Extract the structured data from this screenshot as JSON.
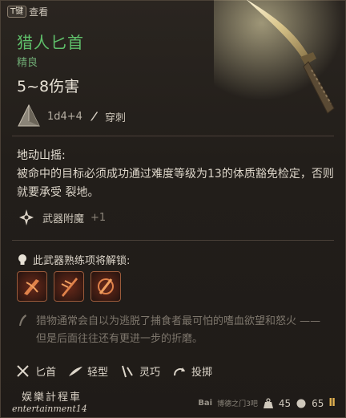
{
  "header": {
    "key_hint": "T键",
    "key_hint_label": "查看"
  },
  "item": {
    "name": "猎人匕首",
    "rarity": "精良",
    "damage": "5~8伤害",
    "damage_dice": "1d4+4",
    "damage_type": "穿刺"
  },
  "ability": {
    "title": "地动山摇:",
    "description": "被命中的目标必须成功通过难度等级为13的体质豁免检定，否则就要承受 裂地。"
  },
  "enchantment": {
    "label": "武器附魔",
    "bonus": "+1"
  },
  "proficiency": {
    "title": "此武器熟练项将解锁:",
    "skills": [
      "skill-1",
      "skill-2",
      "skill-3"
    ]
  },
  "lore": "猎物通常会自以为逃脱了捕食者最可怕的嗜血欲望和怒火 —— 但是后面往往还有更进一步的折磨。",
  "properties": [
    {
      "icon": "dagger-icon",
      "label": "匕首"
    },
    {
      "icon": "feather-icon",
      "label": "轻型"
    },
    {
      "icon": "finesse-icon",
      "label": "灵巧"
    },
    {
      "icon": "throw-icon",
      "label": "投掷"
    }
  ],
  "footer": {
    "watermark_line1": "娱樂計程車",
    "watermark_line2": "entertainment14",
    "weight": "45",
    "value": "65",
    "baidu": "Bai",
    "baidu_sub": "博德之门3吧"
  },
  "colors": {
    "name": "#5fbf6a",
    "rarity": "#6ea873",
    "lore": "#7d766c",
    "pip": "#e0b050"
  }
}
